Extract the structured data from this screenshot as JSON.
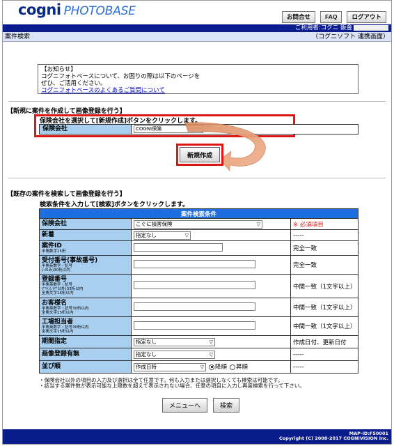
{
  "header": {
    "logo_cogni": "cogni",
    "logo_photobase": "PHOTOBASE",
    "buttons": {
      "inquiry": "お問合せ",
      "faq": "FAQ",
      "logout": "ログアウト"
    },
    "user_label": "ご利用者:コグニ 鈑金"
  },
  "titlebar": {
    "title": "案件検索",
    "mode": "（コグニソフト 連携画面）"
  },
  "notice": {
    "heading": "【お知らせ】",
    "line1": "コグニフォトベースについて、お困りの際は以下のページを",
    "line2": "ぜひ、ご活用ください。",
    "link": "コグニフォトベースのよくあるご質問について"
  },
  "new_section": {
    "title": "【新規に案件を作成して画像登録を行う】",
    "instruction": "保険会社を選択して[新規作成]ボタンをクリックします。",
    "company_label": "保険会社",
    "company_value": "COGNI保険",
    "create_button": "新規作成"
  },
  "search_section": {
    "title": "【既存の案件を検索して画像登録を行う】",
    "instruction": "検索条件を入力して[検索]ボタンをクリックします。",
    "caption": "案件検索条件",
    "rows": [
      {
        "label": "保険会社",
        "sub": "",
        "control": "select",
        "value": "こぐに損害保険",
        "desc": "※ 必須項目",
        "required": true
      },
      {
        "label": "新着",
        "sub": "",
        "control": "select",
        "value": "指定なし",
        "desc": "-----"
      },
      {
        "label": "案件ID",
        "sub": "半角数字15桁",
        "control": "text",
        "desc": "完全一致"
      },
      {
        "label": "受付番号(事故番号)",
        "sub": "半角英数字・記号\n(-のみ)30桁以内",
        "control": "text",
        "desc": "完全一致"
      },
      {
        "label": "登録番号",
        "sub": "半角英数字・記号\n(\"*/:(;)*\"以外)33桁以内\n全角文字16桁以内",
        "control": "text",
        "desc": "中間一致（1文字以上）"
      },
      {
        "label": "お客様名",
        "sub": "半角英数字・記号30桁以内\n全角文字15桁以内",
        "control": "text",
        "desc": "中間一致（1文字以上）"
      },
      {
        "label": "工場担当者",
        "sub": "半角英数字・記号30桁以内\n全角文字15桁以内",
        "control": "text",
        "desc": "中間一致（1文字以上）"
      },
      {
        "label": "期間指定",
        "sub": "",
        "control": "select",
        "value": "指定なし",
        "desc": "作成日付、更新日付"
      },
      {
        "label": "画像登録有無",
        "sub": "",
        "control": "select",
        "value": "指定なし",
        "desc": "-----"
      },
      {
        "label": "並び順",
        "sub": "",
        "control": "sort",
        "value": "作成日時",
        "radio_desc": "降順",
        "radio_asc": "昇順",
        "desc": "-----"
      }
    ],
    "notes": [
      "・保険会社以外の項目の入力及び選択は全て任意です。何も入力または選択しなくても検索は可能です。",
      "・該当する案件数が表示可能な上限数を超えて表示されない場合、任意の項目に入力し再度検索を行って下さい。"
    ],
    "menu_button": "メニューへ",
    "search_button": "検索"
  },
  "footer": {
    "page_id": "MAP-ID:F50001",
    "copyright": "Copyright (C) 2008-2017 COGNIVISION Inc."
  },
  "colors": {
    "navy": "#0b1c8c",
    "label_blue": "#a8cff0",
    "header_blue": "#1d6ee0",
    "highlight_red": "#e01414",
    "arrow_orange": "#e6925e"
  }
}
